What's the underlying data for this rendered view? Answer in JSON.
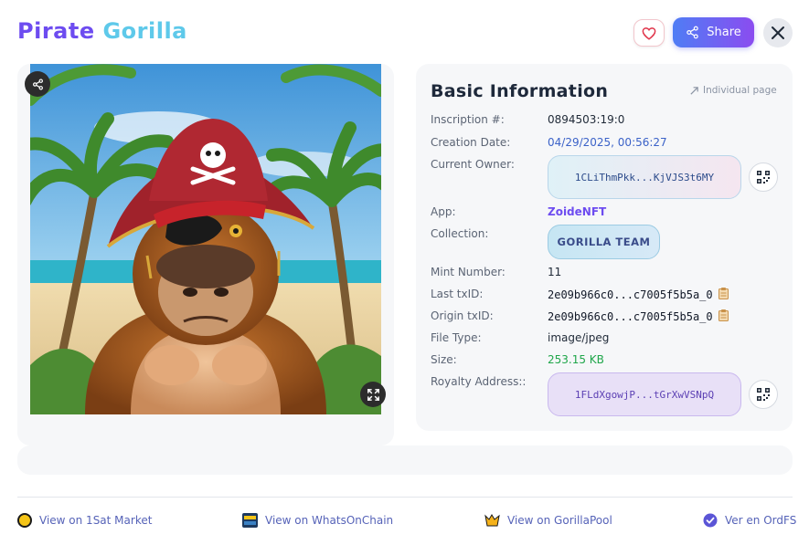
{
  "header": {
    "title_part1": "Pirate",
    "title_part2": "Gorilla",
    "share_label": "Share",
    "brand_color_1": "#6d4cf0",
    "brand_color_2": "#5ec9ea"
  },
  "image": {
    "icons": [
      "share-icon",
      "expand-icon"
    ]
  },
  "info": {
    "title": "Basic Information",
    "individual_page": "Individual page",
    "rows": {
      "inscription_label": "Inscription #:",
      "inscription_value": "0894503:19:0",
      "creation_label": "Creation Date:",
      "creation_value": "04/29/2025, 00:56:27",
      "owner_label": "Current Owner:",
      "owner_value": "1CLiThmPkk...KjVJS3t6MY",
      "app_label": "App:",
      "app_value": "ZoideNFT",
      "collection_label": "Collection:",
      "collection_value": "GORILLA TEAM",
      "mint_label": "Mint Number:",
      "mint_value": "11",
      "last_txid_label": "Last txID:",
      "last_txid_value": "2e09b966c0...c7005f5b5a_0",
      "origin_txid_label": "Origin txID:",
      "origin_txid_value": "2e09b966c0...c7005f5b5a_0",
      "filetype_label": "File Type:",
      "filetype_value": "image/jpeg",
      "size_label": "Size:",
      "size_value": "253.15 KB",
      "royalty_label": "Royalty Address::",
      "royalty_value": "1FLdXgowjP...tGrXwVSNpQ"
    }
  },
  "footer": {
    "links": [
      {
        "label": "View on 1Sat Market"
      },
      {
        "label": "View on WhatsOnChain"
      },
      {
        "label": "View on GorillaPool"
      },
      {
        "label": "Ver en OrdFS"
      }
    ]
  }
}
